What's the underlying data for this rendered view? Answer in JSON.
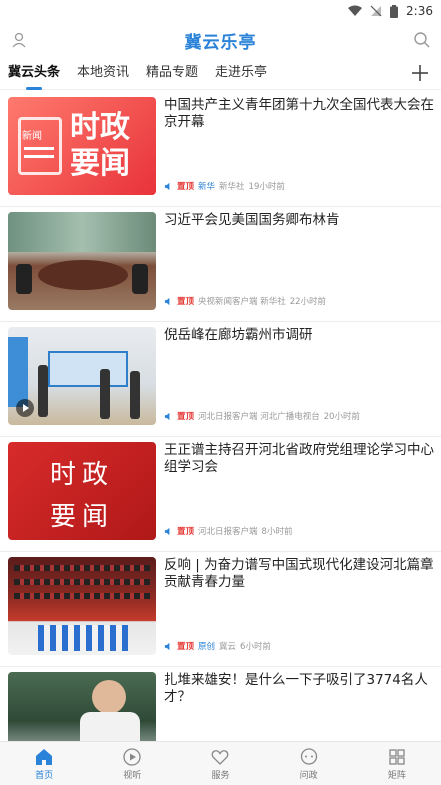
{
  "status_bar": {
    "time": "2:36"
  },
  "header": {
    "title": "冀云乐亭"
  },
  "tabs": [
    {
      "label": "冀云头条"
    },
    {
      "label": "本地资讯"
    },
    {
      "label": "精品专题"
    },
    {
      "label": "走进乐亭"
    }
  ],
  "articles": [
    {
      "headline": "中国共产主义青年团第十九次全国代表大会在京开幕",
      "pin": "置顶",
      "tag": "新华",
      "source": "新华社",
      "time": "19小时前",
      "thumb_text": [
        "时政",
        "要闻"
      ],
      "thumb_small": "新闻"
    },
    {
      "headline": "习近平会见美国国务卿布林肯",
      "pin": "置顶",
      "tag": "",
      "source": "央视新闻客户端 新华社",
      "time": "22小时前"
    },
    {
      "headline": "倪岳峰在廊坊霸州市调研",
      "pin": "置顶",
      "tag": "",
      "source": "河北日报客户端 河北广播电视台",
      "time": "20小时前"
    },
    {
      "headline": "王正谱主持召开河北省政府党组理论学习中心组学习会",
      "pin": "置顶",
      "tag": "",
      "source": "河北日报客户端",
      "time": "8小时前",
      "thumb_text": [
        "时政",
        "要闻"
      ]
    },
    {
      "headline": "反响 | 为奋力谱写中国式现代化建设河北篇章贡献青春力量",
      "pin": "置顶",
      "tag": "原创",
      "source": "冀云",
      "time": "6小时前"
    },
    {
      "headline": "扎堆来雄安！是什么一下子吸引了3774名人才？",
      "pin": "",
      "tag": "",
      "source": "",
      "time": ""
    }
  ],
  "bottom_nav": [
    {
      "label": "首页",
      "icon": "home-icon"
    },
    {
      "label": "视听",
      "icon": "play-circle-icon"
    },
    {
      "label": "服务",
      "icon": "heart-icon"
    },
    {
      "label": "问政",
      "icon": "chat-icon"
    },
    {
      "label": "矩阵",
      "icon": "grid-icon"
    }
  ],
  "colors": {
    "accent": "#2a83d8",
    "pin": "#e53935"
  }
}
